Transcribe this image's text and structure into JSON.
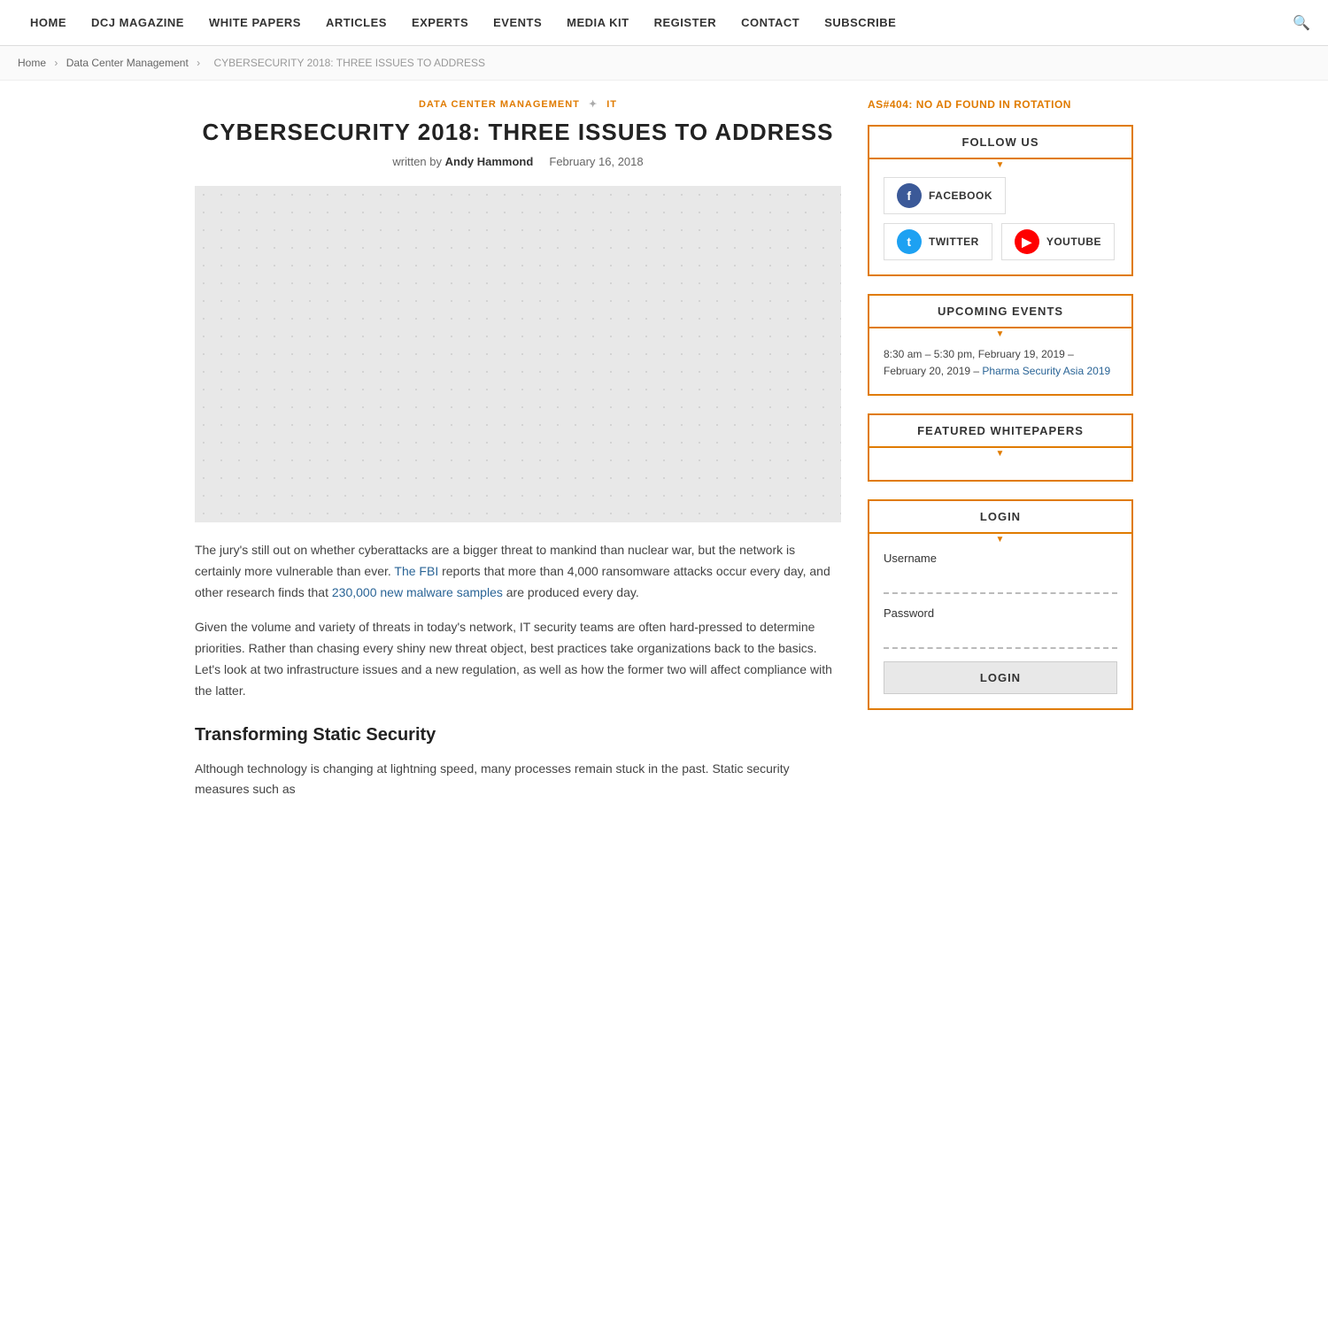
{
  "nav": {
    "items": [
      {
        "label": "HOME",
        "id": "home"
      },
      {
        "label": "DCJ MAGAZINE",
        "id": "dcj-magazine"
      },
      {
        "label": "WHITE PAPERS",
        "id": "white-papers"
      },
      {
        "label": "ARTICLES",
        "id": "articles"
      },
      {
        "label": "EXPERTS",
        "id": "experts"
      },
      {
        "label": "EVENTS",
        "id": "events"
      },
      {
        "label": "MEDIA KIT",
        "id": "media-kit"
      },
      {
        "label": "REGISTER",
        "id": "register"
      },
      {
        "label": "CONTACT",
        "id": "contact"
      },
      {
        "label": "SUBSCRIBE",
        "id": "subscribe"
      }
    ]
  },
  "breadcrumb": {
    "items": [
      "Home",
      "Data Center Management",
      "Cybersecurity 2018: Three Issues to Address"
    ]
  },
  "article": {
    "tag1": "DATA CENTER MANAGEMENT",
    "tag2": "IT",
    "title": "CYBERSECURITY 2018: THREE ISSUES TO ADDRESS",
    "written_by_label": "written by",
    "author": "Andy Hammond",
    "date": "February 16, 2018",
    "body_p1": "The jury's still out on whether cyberattacks are a bigger threat to mankind than nuclear war, but the network is certainly more vulnerable than ever.",
    "fbi_link": "The FBI",
    "body_p1_mid": " reports that more than 4,000 ransomware attacks occur every day, and other research finds that ",
    "malware_link": "230,000 new malware samples",
    "body_p1_end": " are produced every day.",
    "body_p2": "Given the volume and variety of threats in today's network, IT security teams are often hard-pressed to determine priorities. Rather than chasing every shiny new threat object, best practices take organizations back to the basics. Let's look at two infrastructure issues and a new regulation, as well as how the former two will affect compliance with the latter.",
    "section1_title": "Transforming Static Security",
    "body_p3": "Although technology is changing at lightning speed, many processes remain stuck in the past. Static security measures such as"
  },
  "sidebar": {
    "ad_text": "AS#404: NO AD FOUND IN ROTATION",
    "follow_us": {
      "header": "FOLLOW US",
      "buttons": [
        {
          "label": "FACEBOOK",
          "type": "facebook",
          "icon": "f"
        },
        {
          "label": "TWITTER",
          "type": "twitter",
          "icon": "t"
        },
        {
          "label": "YOUTUBE",
          "type": "youtube",
          "icon": "▶"
        }
      ]
    },
    "upcoming_events": {
      "header": "UPCOMING EVENTS",
      "event_time": "8:30 am – 5:30 pm, February 19, 2019 – February 20, 2019 –",
      "event_link_text": "Pharma Security Asia 2019"
    },
    "featured_whitepapers": {
      "header": "FEATURED WHITEPAPERS"
    },
    "login": {
      "header": "LOGIN",
      "username_label": "Username",
      "password_label": "Password",
      "button_label": "LOGIN"
    }
  }
}
